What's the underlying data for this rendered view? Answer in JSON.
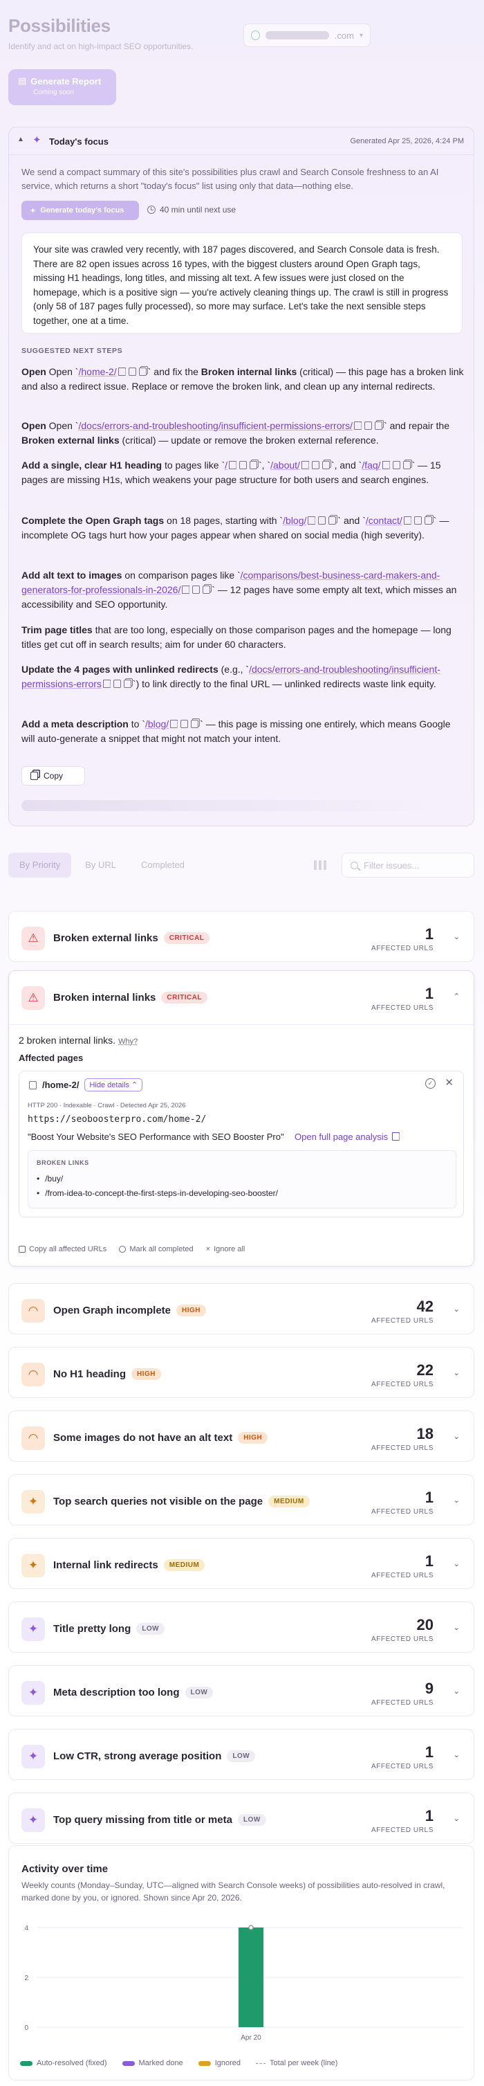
{
  "header": {
    "title": "Possibilities",
    "subtitle": "Identify and act on high-impact SEO opportunities.",
    "domain_suffix": ".com",
    "generate_report": "Generate Report",
    "generate_report_note": "Coming soon"
  },
  "focus": {
    "title": "Today's focus",
    "generated": "Generated Apr 25, 2026, 4:24 PM",
    "intro": "We send a compact summary of this site's possibilities plus crawl and Search Console freshness to an AI service, which returns a short \"today's focus\" list using only that data—nothing else.",
    "generate_button": "Generate today's focus",
    "next_use": "40 min until next use",
    "summary": "Your site was crawled very recently, with 187 pages discovered, and Search Console data is fresh. There are 82 open issues across 16 types, with the biggest clusters around Open Graph tags, missing H1 headings, long titles, and missing alt text. A few issues were just closed on the homepage, which is a positive sign — you're actively cleaning things up. The crawl is still in progress (only 58 of 187 pages fully processed), so more may surface. Let's take the next sensible steps together, one at a time.",
    "steps_label": "SUGGESTED NEXT STEPS",
    "steps": [
      {
        "a": "Open `",
        "link": "/home-2/",
        "b": "` and fix the ",
        "strong": "Broken internal links",
        "c": " (critical) — this page has a broken link and also a redirect issue. Replace or remove the broken link, and clean up any internal redirects."
      },
      {
        "a": "Open `",
        "link": "/docs/errors-and-troubleshooting/insufficient-permissions-errors/",
        "b": "` and repair the ",
        "strong": "Broken external links",
        "c": " (critical) — update or remove the broken external reference."
      },
      {
        "strong1": "Add a single, clear H1 heading",
        "a": " to pages like `",
        "link1": "/",
        "b": "`, `",
        "link2": "/about/",
        "c": "`, and `",
        "link3": "/faq/",
        "d": "` — 15 pages are missing H1s, which weakens your page structure for both users and search engines."
      },
      {
        "strong1": "Complete the Open Graph tags",
        "a": " on 18 pages, starting with `",
        "link1": "/blog/",
        "b": "` and `",
        "link2": "/contact/",
        "c": "` — incomplete OG tags hurt how your pages appear when shared on social media (high severity)."
      },
      {
        "strong1": "Add alt text to images",
        "a": " on comparison pages like `",
        "link1": "/comparisons/best-business-card-makers-and-generators-for-professionals-in-2026/",
        "b": "` — 12 pages have some empty alt text, which misses an accessibility and SEO opportunity."
      },
      {
        "strong1": "Trim page titles",
        "a": " that are too long, especially on those comparison pages and the homepage — long titles get cut off in search results; aim for under 60 characters."
      },
      {
        "strong1": "Update the 4 pages with unlinked redirects",
        "a": " (e.g., `",
        "link1": "/docs/errors-and-troubleshooting/insufficient-permissions-errors",
        "b": "`) to link directly to the final URL — unlinked redirects waste link equity."
      },
      {
        "strong1": "Add a meta description",
        "a": " to `",
        "link1": "/blog/",
        "b": "` — this page is missing one entirely, which means Google will auto-generate a snippet that might not match your intent."
      }
    ],
    "copy": "Copy"
  },
  "tabs": [
    "By Priority",
    "By URL",
    "Completed"
  ],
  "filter_placeholder": "Filter issues...",
  "affected_label": "AFFECTED URLS",
  "issues": [
    {
      "name": "Broken external links",
      "severity": "CRITICAL",
      "count": "1",
      "icon": "warning-triangle-icon"
    },
    {
      "name": "Broken internal links",
      "severity": "CRITICAL",
      "count": "1",
      "icon": "warning-triangle-icon"
    },
    {
      "name": "Open Graph incomplete",
      "severity": "HIGH",
      "count": "42",
      "icon": "gauge-icon"
    },
    {
      "name": "No H1 heading",
      "severity": "HIGH",
      "count": "22",
      "icon": "gauge-icon"
    },
    {
      "name": "Some images do not have an alt text",
      "severity": "HIGH",
      "count": "18",
      "icon": "gauge-icon"
    },
    {
      "name": "Top search queries not visible on the page",
      "severity": "MEDIUM",
      "count": "1",
      "icon": "sparkle-icon"
    },
    {
      "name": "Internal link redirects",
      "severity": "MEDIUM",
      "count": "1",
      "icon": "sparkle-icon"
    },
    {
      "name": "Title pretty long",
      "severity": "LOW",
      "count": "20",
      "icon": "sparkle-icon"
    },
    {
      "name": "Meta description too long",
      "severity": "LOW",
      "count": "9",
      "icon": "sparkle-icon"
    },
    {
      "name": "Low CTR, strong average position",
      "severity": "LOW",
      "count": "1",
      "icon": "sparkle-icon"
    },
    {
      "name": "Top query missing from title or meta",
      "severity": "LOW",
      "count": "1",
      "icon": "sparkle-icon"
    }
  ],
  "expanded": {
    "count_text": "2 broken internal links.",
    "why": "Why?",
    "affected_pages": "Affected pages",
    "page_path": "/home-2/",
    "hide_details": "Hide details",
    "meta": "HTTP 200 · Indexable · Crawl · Detected Apr 25, 2026",
    "url": "https://seoboosterpro.com/home-2/",
    "page_title": "\"Boost Your Website's SEO Performance with SEO Booster Pro\"",
    "full_analysis": "Open full page analysis",
    "broken_links_label": "BROKEN LINKS",
    "broken_links": [
      "/buy/",
      "/from-idea-to-concept-the-first-steps-in-developing-seo-booster/"
    ],
    "copy_all": "Copy all affected URLs",
    "mark_all": "Mark all completed",
    "ignore_all": "Ignore all"
  },
  "activity": {
    "title": "Activity over time",
    "description": "Weekly counts (Monday–Sunday, UTC—aligned with Search Console weeks) of possibilities auto-resolved in crawl, marked done by you, or ignored. Shown since Apr 20, 2026.",
    "legend": [
      "Auto-resolved (fixed)",
      "Marked done",
      "Ignored",
      "Total per week (line)"
    ]
  },
  "colors": {
    "accent": "#7a3fd1",
    "auto_resolved": "#1f9a6a",
    "marked_done": "#8a5cd6",
    "ignored": "#e0a020"
  },
  "chart_data": {
    "type": "bar",
    "categories": [
      "Apr 20"
    ],
    "series": [
      {
        "name": "Auto-resolved (fixed)",
        "values": [
          4
        ]
      },
      {
        "name": "Marked done",
        "values": [
          0
        ]
      },
      {
        "name": "Ignored",
        "values": [
          0
        ]
      },
      {
        "name": "Total per week (line)",
        "values": [
          4
        ]
      }
    ],
    "yticks": [
      0,
      2,
      4
    ],
    "ylim": [
      0,
      4
    ],
    "title": "Activity over time",
    "legend_position": "bottom"
  }
}
